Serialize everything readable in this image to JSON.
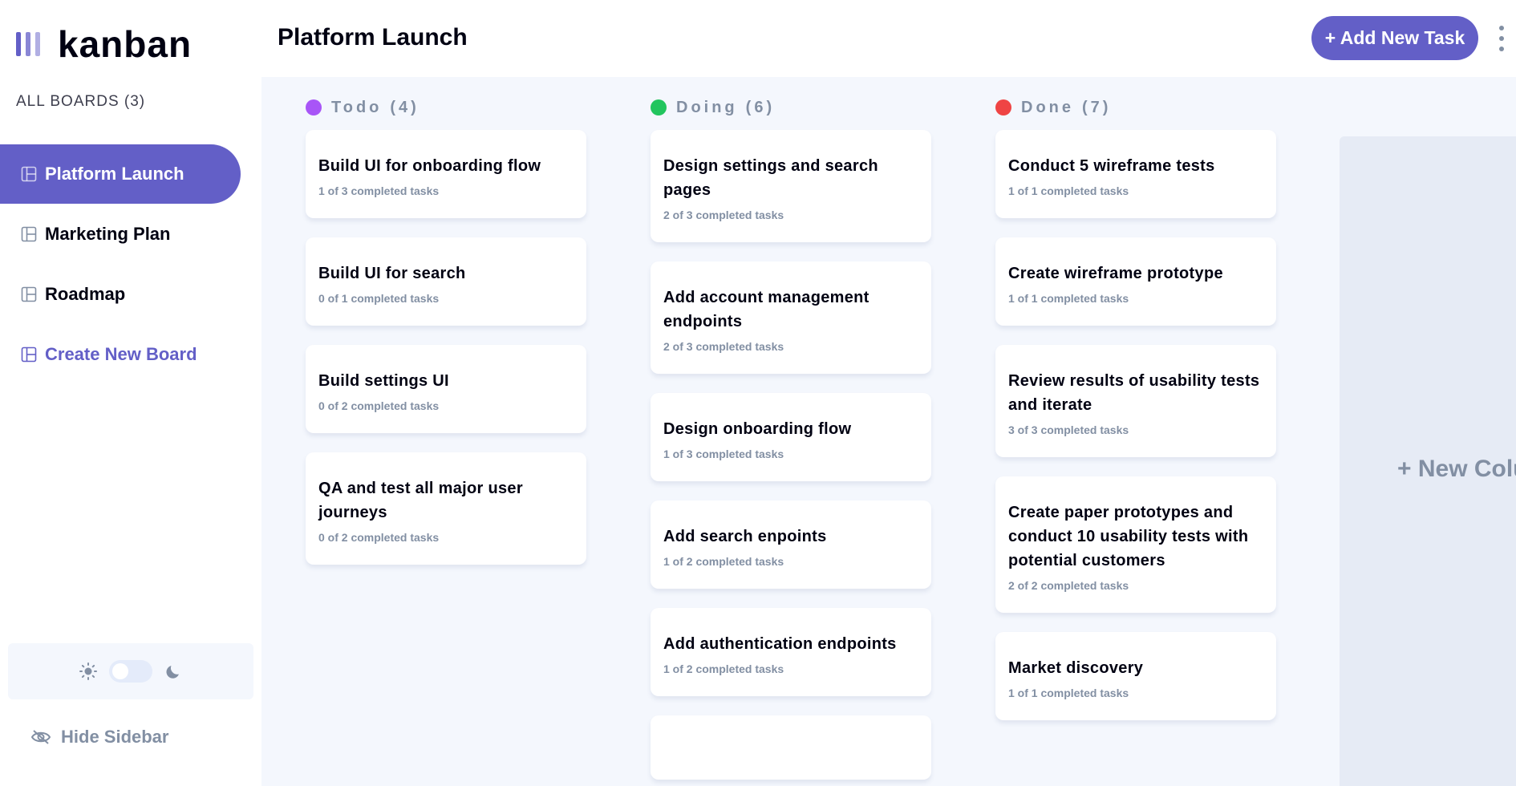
{
  "app": {
    "logo_text": "kanban",
    "brand_color": "#635fc7"
  },
  "sidebar": {
    "all_boards_label": "ALL BOARDS (3)",
    "boards": [
      {
        "label": "Platform Launch",
        "active": true
      },
      {
        "label": "Marketing Plan",
        "active": false
      },
      {
        "label": "Roadmap",
        "active": false
      }
    ],
    "create_board_label": "Create New Board",
    "hide_sidebar_label": "Hide Sidebar"
  },
  "header": {
    "board_title": "Platform Launch",
    "add_task_label": "+ Add New Task"
  },
  "columns": [
    {
      "name": "Todo",
      "count": "(4)",
      "dot_color": "#a855f7",
      "cards": [
        {
          "title": "Build UI for onboarding flow",
          "subtasks": "1 of 3 completed tasks"
        },
        {
          "title": "Build UI for search",
          "subtasks": "0 of 1 completed tasks"
        },
        {
          "title": "Build settings UI",
          "subtasks": "0 of 2 completed tasks"
        },
        {
          "title": "QA and test all major user journeys",
          "subtasks": "0 of 2 completed tasks"
        }
      ]
    },
    {
      "name": "Doing",
      "count": "(6)",
      "dot_color": "#22c55e",
      "cards": [
        {
          "title": "Design settings and search pages",
          "subtasks": "2 of 3 completed tasks"
        },
        {
          "title": "Add account management endpoints",
          "subtasks": "2 of 3 completed tasks"
        },
        {
          "title": "Design onboarding flow",
          "subtasks": "1 of 3 completed tasks"
        },
        {
          "title": "Add search enpoints",
          "subtasks": "1 of 2 completed tasks"
        },
        {
          "title": "Add authentication endpoints",
          "subtasks": "1 of 2 completed tasks"
        }
      ]
    },
    {
      "name": "Done",
      "count": "(7)",
      "dot_color": "#ef4444",
      "cards": [
        {
          "title": "Conduct 5 wireframe tests",
          "subtasks": "1 of 1 completed tasks"
        },
        {
          "title": "Create wireframe prototype",
          "subtasks": "1 of 1 completed tasks"
        },
        {
          "title": "Review results of usability tests and iterate",
          "subtasks": "3 of 3 completed tasks"
        },
        {
          "title": "Create paper prototypes and conduct 10 usability tests with potential customers",
          "subtasks": "2 of 2 completed tasks"
        },
        {
          "title": "Market discovery",
          "subtasks": "1 of 1 completed tasks"
        }
      ]
    }
  ],
  "new_column_label": "+ New Column",
  "icons": {
    "logo": "kanban-bars-icon",
    "board": "board-icon",
    "light": "sun-icon",
    "dark": "moon-icon",
    "hide": "eye-slash-icon",
    "menu": "vertical-ellipsis-icon"
  }
}
